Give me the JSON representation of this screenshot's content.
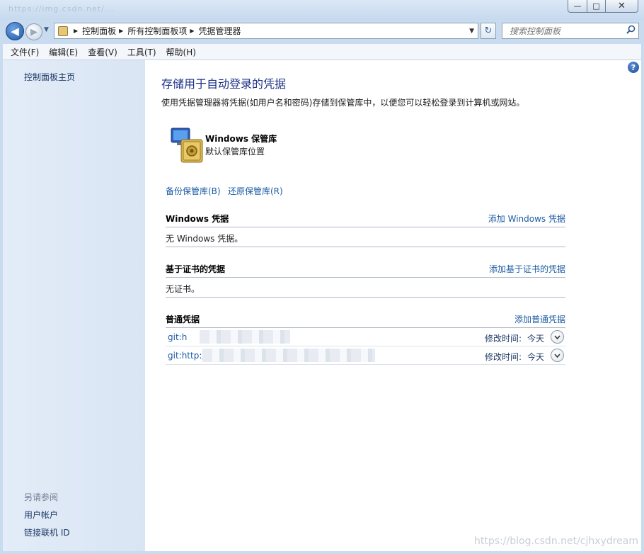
{
  "window": {
    "faded_tab_text": "https://img.csdn.net/...",
    "buttons": {
      "minimize": "—",
      "maximize": "□",
      "close": "✕"
    }
  },
  "nav": {
    "back_glyph": "◀",
    "forward_glyph": "▶",
    "dropdown_glyph": "▼"
  },
  "address": {
    "crumbs": [
      "控制面板",
      "所有控制面板项",
      "凭据管理器"
    ],
    "separator": "▶",
    "dropdown_glyph": "▼"
  },
  "refresh_glyph": "↻",
  "search": {
    "placeholder": "搜索控制面板",
    "icon": "search-icon"
  },
  "menu": [
    "文件(F)",
    "编辑(E)",
    "查看(V)",
    "工具(T)",
    "帮助(H)"
  ],
  "sidebar": {
    "home_link": "控制面板主页",
    "see_also_title": "另请参阅",
    "links": [
      "用户帐户",
      "链接联机 ID"
    ]
  },
  "main": {
    "help_glyph": "?",
    "title": "存储用于自动登录的凭据",
    "description": "使用凭据管理器将凭据(如用户名和密码)存储到保管库中，以便您可以轻松登录到计算机或网站。",
    "vault": {
      "title": "Windows 保管库",
      "subtitle": "默认保管库位置"
    },
    "backup_link": "备份保管库(B)",
    "restore_link": "还原保管库(R)",
    "sections": {
      "windows": {
        "title": "Windows 凭据",
        "add": "添加 Windows 凭据",
        "empty": "无 Windows 凭据。"
      },
      "certificate": {
        "title": "基于证书的凭据",
        "add": "添加基于证书的凭据",
        "empty": "无证书。"
      },
      "generic": {
        "title": "普通凭据",
        "add": "添加普通凭据",
        "items": [
          {
            "name": "git:h",
            "modified_label": "修改时间:",
            "modified_value": "今天"
          },
          {
            "name": "git:http:/",
            "modified_label": "修改时间:",
            "modified_value": "今天"
          }
        ]
      }
    }
  },
  "watermark": "https://blog.csdn.net/cjhxydream",
  "colors": {
    "link": "#1a5ba4",
    "title": "#1e3287",
    "sidebar": "#e0eaf7"
  }
}
